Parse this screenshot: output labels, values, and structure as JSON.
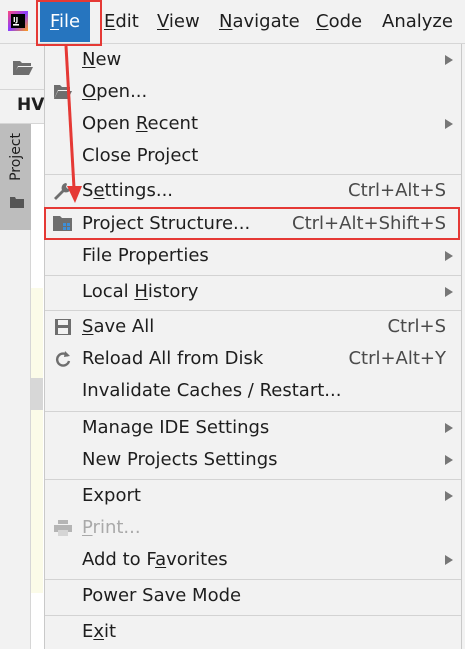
{
  "menubar": {
    "items": [
      {
        "label": "File",
        "mnemonic_index": 0
      },
      {
        "label": "Edit",
        "mnemonic_index": 0
      },
      {
        "label": "View",
        "mnemonic_index": 0
      },
      {
        "label": "Navigate",
        "mnemonic_index": 0
      },
      {
        "label": "Code",
        "mnemonic_index": 0
      },
      {
        "label": "Analyze",
        "mnemonic_index": -1
      }
    ],
    "active": "File"
  },
  "background": {
    "editor_tab": "HV",
    "project_tool_label": "Project"
  },
  "file_menu": {
    "items": [
      {
        "label": "New",
        "mnemonic_index": 0,
        "shortcut": "",
        "submenu": true,
        "icon": ""
      },
      {
        "label": "Open...",
        "mnemonic_index": 0,
        "shortcut": "",
        "submenu": false,
        "icon": "folder-open-icon"
      },
      {
        "label": "Open Recent",
        "mnemonic_index": 5,
        "shortcut": "",
        "submenu": true,
        "icon": ""
      },
      {
        "label": "Close Project",
        "mnemonic_index": -1,
        "shortcut": "",
        "submenu": false,
        "icon": ""
      },
      {
        "label": "Settings...",
        "mnemonic_index": 1,
        "shortcut": "Ctrl+Alt+S",
        "submenu": false,
        "icon": "wrench-icon"
      },
      {
        "label": "Project Structure...",
        "mnemonic_index": -1,
        "shortcut": "Ctrl+Alt+Shift+S",
        "submenu": false,
        "icon": "project-structure-icon"
      },
      {
        "label": "File Properties",
        "mnemonic_index": -1,
        "shortcut": "",
        "submenu": true,
        "icon": ""
      },
      {
        "label": "Local History",
        "mnemonic_index": 6,
        "shortcut": "",
        "submenu": true,
        "icon": ""
      },
      {
        "label": "Save All",
        "mnemonic_index": 0,
        "shortcut": "Ctrl+S",
        "submenu": false,
        "icon": "save-icon"
      },
      {
        "label": "Reload All from Disk",
        "mnemonic_index": -1,
        "shortcut": "Ctrl+Alt+Y",
        "submenu": false,
        "icon": "reload-icon"
      },
      {
        "label": "Invalidate Caches / Restart...",
        "mnemonic_index": -1,
        "shortcut": "",
        "submenu": false,
        "icon": ""
      },
      {
        "label": "Manage IDE Settings",
        "mnemonic_index": -1,
        "shortcut": "",
        "submenu": true,
        "icon": ""
      },
      {
        "label": "New Projects Settings",
        "mnemonic_index": -1,
        "shortcut": "",
        "submenu": true,
        "icon": ""
      },
      {
        "label": "Export",
        "mnemonic_index": -1,
        "shortcut": "",
        "submenu": true,
        "icon": ""
      },
      {
        "label": "Print...",
        "mnemonic_index": 0,
        "shortcut": "",
        "submenu": false,
        "icon": "print-icon",
        "disabled": true
      },
      {
        "label": "Add to Favorites",
        "mnemonic_index": 8,
        "shortcut": "",
        "submenu": true,
        "icon": ""
      },
      {
        "label": "Power Save Mode",
        "mnemonic_index": -1,
        "shortcut": "",
        "submenu": false,
        "icon": ""
      },
      {
        "label": "Exit",
        "mnemonic_index": 1,
        "shortcut": "",
        "submenu": false,
        "icon": ""
      }
    ]
  },
  "annotations": {
    "highlight_color": "#e53935",
    "highlighted": [
      "File",
      "Project Structure..."
    ]
  },
  "colors": {
    "menu_bg": "#f2f2f2",
    "active_menu_bg": "#2675bf",
    "disabled_text": "#a9a9a9"
  }
}
